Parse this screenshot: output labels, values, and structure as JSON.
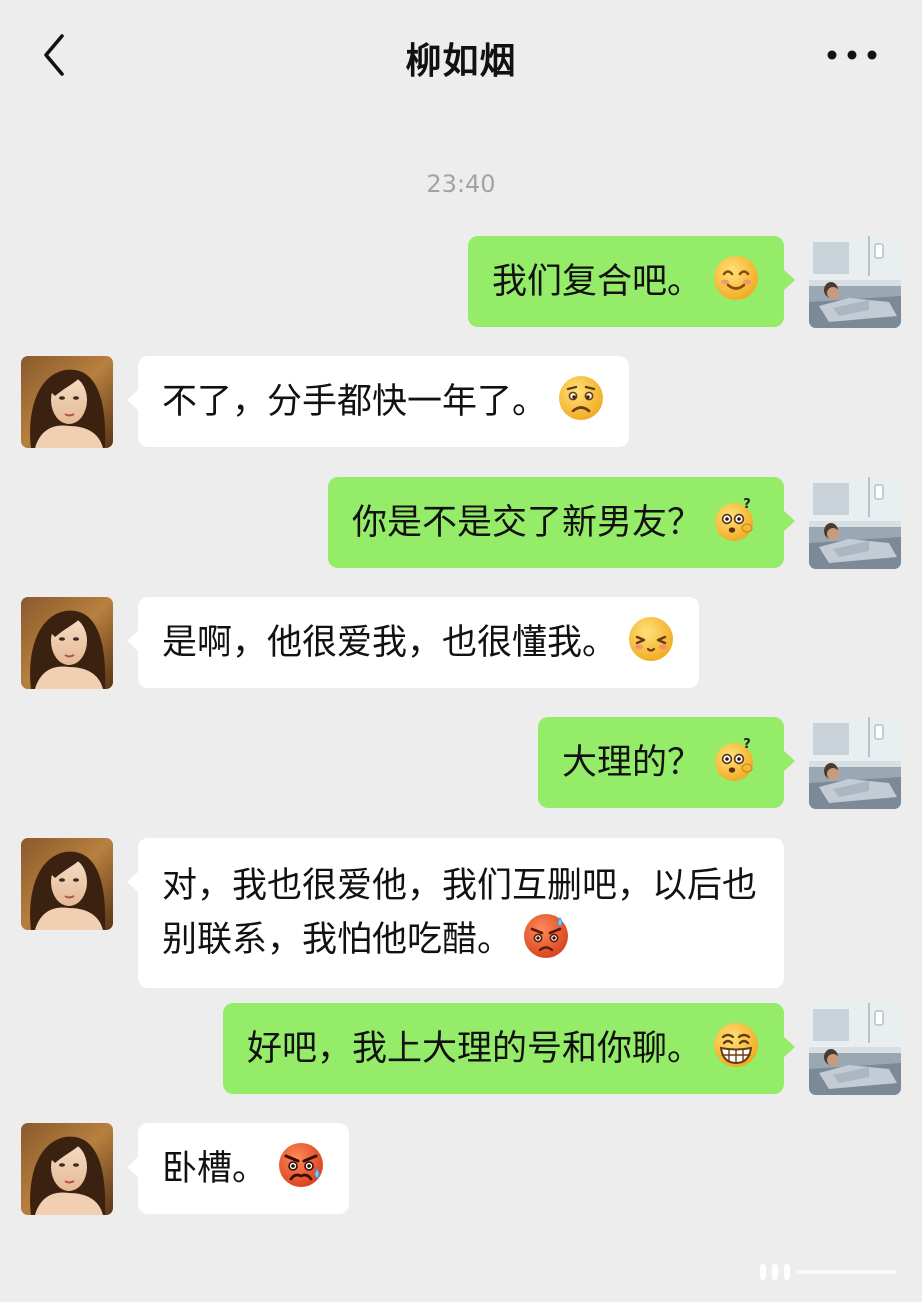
{
  "header": {
    "title": "柳如烟",
    "back_icon": "chevron-left-icon",
    "more_icon": "more-dots-icon"
  },
  "timestamp": "23:40",
  "colors": {
    "background": "#ededed",
    "outgoing_bubble": "#95ec69",
    "incoming_bubble": "#ffffff",
    "timestamp": "#a3a3a3"
  },
  "messages": [
    {
      "direction": "outgoing",
      "text": "我们复合吧。",
      "emoji": "smiling-face-icon"
    },
    {
      "direction": "incoming",
      "text": "不了，分手都快一年了。",
      "emoji": "worried-face-icon"
    },
    {
      "direction": "outgoing",
      "text": "你是不是交了新男友？",
      "emoji": "confused-question-face-icon"
    },
    {
      "direction": "incoming",
      "text": "是啊，他很爱我，也很懂我。",
      "emoji": "blissful-face-icon"
    },
    {
      "direction": "outgoing",
      "text": "大理的？",
      "emoji": "confused-question-face-icon"
    },
    {
      "direction": "incoming",
      "text": "对，我也很爱他，我们互删吧，以后也别联系，我怕他吃醋。",
      "emoji": "angry-sweat-face-icon"
    },
    {
      "direction": "outgoing",
      "text": "好吧，我上大理的号和你聊。",
      "emoji": "grinning-face-icon"
    },
    {
      "direction": "incoming",
      "text": "卧槽。",
      "emoji": "angry-face-icon"
    }
  ]
}
